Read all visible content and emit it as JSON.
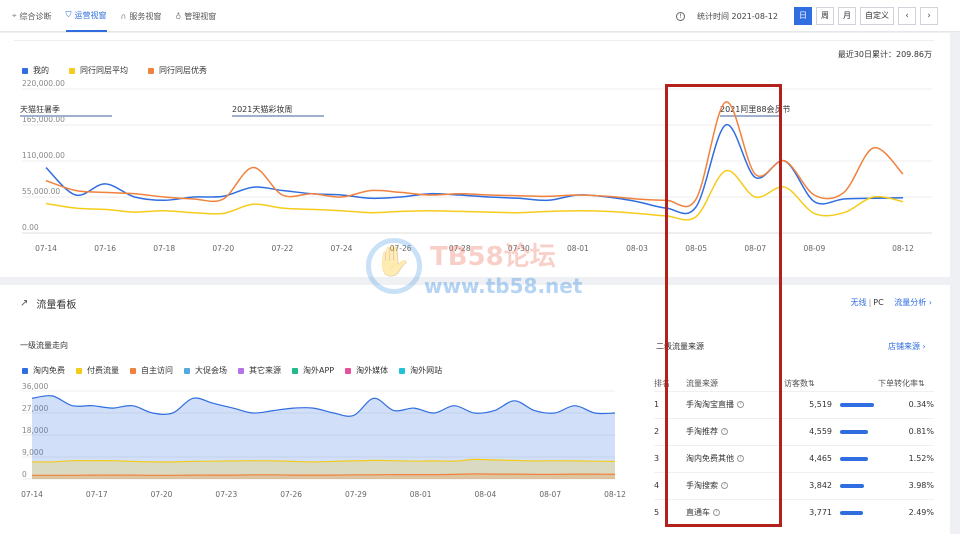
{
  "nav": {
    "items": [
      {
        "label": "综合诊断",
        "icon": "pin-icon"
      },
      {
        "label": "运营视窗",
        "icon": "shield-icon"
      },
      {
        "label": "服务视窗",
        "icon": "headset-icon"
      },
      {
        "label": "管理视窗",
        "icon": "medal-icon"
      }
    ],
    "active_index": 1
  },
  "header": {
    "stat_time": "统计时间 2021-08-12",
    "period_buttons": [
      "日",
      "周",
      "月",
      "自定义"
    ],
    "active_period": "日",
    "prev_icon": "chevron-left-icon",
    "next_icon": "chevron-right-icon"
  },
  "trend": {
    "total": "最近30日累计：209.86万",
    "legend": [
      {
        "name": "我的",
        "color": "#2f6de1"
      },
      {
        "name": "同行同层平均",
        "color": "#f5cc1b"
      },
      {
        "name": "同行同层优秀",
        "color": "#f0823d"
      }
    ],
    "annotations": [
      "天猫狂暑季",
      "2021天猫彩妆周",
      "2021阿里88会员节"
    ]
  },
  "flow": {
    "title": "流量看板",
    "links": {
      "wireless": "无线",
      "pc": "PC",
      "analysis": "流量分析"
    },
    "first_level_title": "一级流量走向",
    "legend": [
      {
        "name": "淘内免费",
        "color": "#2f6de1"
      },
      {
        "name": "付费流量",
        "color": "#f5cc1b"
      },
      {
        "name": "自主访问",
        "color": "#f0823d"
      },
      {
        "name": "大促会场",
        "color": "#56a9e0"
      },
      {
        "name": "其它来源",
        "color": "#b274e6"
      },
      {
        "name": "淘外APP",
        "color": "#1fb98a"
      },
      {
        "name": "淘外媒体",
        "color": "#e8509a"
      },
      {
        "name": "淘外网站",
        "color": "#1ec3d6"
      }
    ],
    "second_level_title": "二级流量来源",
    "store_source_link": "店铺来源",
    "table": {
      "headers": [
        "排名",
        "流量来源",
        "访客数",
        "下单转化率"
      ],
      "rows": [
        {
          "rank": "1",
          "source": "手淘淘宝直播",
          "visitors": "5,519",
          "share": 1.0,
          "rate": "0.34%"
        },
        {
          "rank": "2",
          "source": "手淘推荐",
          "visitors": "4,559",
          "share": 0.83,
          "rate": "0.81%"
        },
        {
          "rank": "3",
          "source": "淘内免费其他",
          "visitors": "4,465",
          "share": 0.81,
          "rate": "1.52%"
        },
        {
          "rank": "4",
          "source": "手淘搜索",
          "visitors": "3,842",
          "share": 0.7,
          "rate": "3.98%"
        },
        {
          "rank": "5",
          "source": "直通车",
          "visitors": "3,771",
          "share": 0.68,
          "rate": "2.49%"
        }
      ]
    }
  },
  "watermark": {
    "line1": "TB58论坛",
    "line2": "www.tb58.net"
  },
  "chart_data": [
    {
      "type": "line",
      "ylim": [
        0,
        220000
      ],
      "yticks": [
        "0.00",
        "55,000.00",
        "110,000.00",
        "165,000.00",
        "220,000.00"
      ],
      "ytick_values": [
        0,
        55000,
        110000,
        165000,
        220000
      ],
      "xticks": [
        "07-14",
        "07-16",
        "07-18",
        "07-20",
        "07-22",
        "07-24",
        "07-26",
        "07-28",
        "07-30",
        "08-01",
        "08-03",
        "08-05",
        "08-07",
        "08-09",
        "08-12"
      ],
      "x": [
        "07-14",
        "07-15",
        "07-16",
        "07-17",
        "07-18",
        "07-19",
        "07-20",
        "07-21",
        "07-22",
        "07-23",
        "07-24",
        "07-25",
        "07-26",
        "07-27",
        "07-28",
        "07-29",
        "07-30",
        "07-31",
        "08-01",
        "08-02",
        "08-03",
        "08-04",
        "08-05",
        "08-06",
        "08-07",
        "08-08",
        "08-09",
        "08-10",
        "08-11",
        "08-12"
      ],
      "series": [
        {
          "name": "我的",
          "color": "#2f6de1",
          "values": [
            100000,
            58000,
            75000,
            55000,
            50000,
            55000,
            56000,
            70000,
            65000,
            60000,
            58000,
            53000,
            55000,
            60000,
            58000,
            55000,
            53000,
            50000,
            58000,
            55000,
            48000,
            38000,
            40000,
            165000,
            85000,
            110000,
            48000,
            52000,
            53000,
            54000
          ]
        },
        {
          "name": "同行同层平均",
          "color": "#f5cc1b",
          "values": [
            45000,
            38000,
            36000,
            32000,
            34000,
            31000,
            30000,
            44000,
            38000,
            36000,
            34000,
            31000,
            33000,
            34000,
            33000,
            32000,
            31000,
            33000,
            34000,
            33000,
            30000,
            26000,
            25000,
            95000,
            55000,
            70000,
            30000,
            31000,
            55000,
            48000
          ]
        },
        {
          "name": "同行同层优秀",
          "color": "#f0823d",
          "values": [
            80000,
            65000,
            62000,
            60000,
            55000,
            52000,
            52000,
            100000,
            58000,
            60000,
            55000,
            65000,
            62000,
            58000,
            60000,
            58000,
            57000,
            56000,
            58000,
            56000,
            52000,
            50000,
            52000,
            200000,
            90000,
            110000,
            58000,
            62000,
            130000,
            90000
          ]
        }
      ],
      "legend_position": "top-left",
      "grid": true
    },
    {
      "type": "area",
      "ylim": [
        0,
        36000
      ],
      "yticks": [
        "0",
        "9,000",
        "18,000",
        "27,000",
        "36,000"
      ],
      "ytick_values": [
        0,
        9000,
        18000,
        27000,
        36000
      ],
      "xticks": [
        "07-14",
        "07-17",
        "07-20",
        "07-23",
        "07-26",
        "07-29",
        "08-01",
        "08-04",
        "08-07",
        "08-12"
      ],
      "series": [
        {
          "name": "淘内免费",
          "color": "#2f6de1",
          "values": [
            33000,
            34000,
            30000,
            30000,
            29000,
            30000,
            27000,
            27000,
            33000,
            31000,
            29000,
            27000,
            28000,
            29000,
            29000,
            27000,
            26000,
            33000,
            28000,
            29000,
            27000,
            30000,
            27000,
            28000,
            32000,
            28000,
            27000,
            30000,
            27000,
            27000
          ]
        },
        {
          "name": "付费流量",
          "color": "#f5cc1b",
          "values": [
            7000,
            7000,
            7500,
            7500,
            7500,
            7200,
            7000,
            7000,
            7200,
            7300,
            7400,
            7500,
            7400,
            7200,
            7000,
            7200,
            7400,
            7600,
            7500,
            7300,
            7400,
            7300,
            8000,
            7800,
            7600,
            7400,
            7500,
            7400,
            7300,
            7200
          ]
        },
        {
          "name": "自主访问",
          "color": "#f0823d",
          "values": [
            1500,
            1500,
            1500,
            1600,
            1600,
            1600,
            1500,
            1500,
            1600,
            1600,
            1600,
            1700,
            1700,
            1600,
            1600,
            1600,
            1700,
            1700,
            1800,
            1800,
            1800,
            1900,
            2100,
            2000,
            2000,
            1900,
            1900,
            2000,
            2000,
            1900
          ]
        }
      ],
      "legend_position": "top-left",
      "grid": true
    }
  ]
}
